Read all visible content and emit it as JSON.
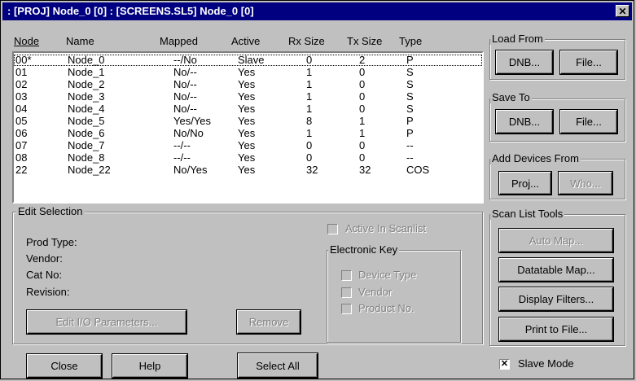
{
  "window": {
    "title": ": [PROJ] Node_0 [0] : [SCREENS.SL5] Node_0 [0]"
  },
  "table": {
    "headers": [
      "Node",
      "Name",
      "Mapped",
      "Active",
      "Rx Size",
      "Tx Size",
      "Type"
    ],
    "rows": [
      [
        "00*",
        "Node_0",
        "--/No",
        "Slave",
        "0",
        "2",
        "P"
      ],
      [
        "01",
        "Node_1",
        "No/--",
        "Yes",
        "1",
        "0",
        "S"
      ],
      [
        "02",
        "Node_2",
        "No/--",
        "Yes",
        "1",
        "0",
        "S"
      ],
      [
        "03",
        "Node_3",
        "No/--",
        "Yes",
        "1",
        "0",
        "S"
      ],
      [
        "04",
        "Node_4",
        "No/--",
        "Yes",
        "1",
        "0",
        "S"
      ],
      [
        "05",
        "Node_5",
        "Yes/Yes",
        "Yes",
        "8",
        "1",
        "P"
      ],
      [
        "06",
        "Node_6",
        "No/No",
        "Yes",
        "1",
        "1",
        "P"
      ],
      [
        "07",
        "Node_7",
        "--/--",
        "Yes",
        "0",
        "0",
        "--"
      ],
      [
        "08",
        "Node_8",
        "--/--",
        "Yes",
        "0",
        "0",
        "--"
      ],
      [
        "22",
        "Node_22",
        "No/Yes",
        "Yes",
        "32",
        "32",
        "COS"
      ]
    ]
  },
  "edit_selection": {
    "label": "Edit Selection",
    "prod_type": "Prod Type:",
    "vendor": "Vendor:",
    "cat_no": "Cat No:",
    "revision": "Revision:",
    "active_in_scanlist": "Active In Scanlist",
    "electronic_key": {
      "label": "Electronic Key",
      "device_type": "Device Type",
      "vendor": "Vendor",
      "product_no": "Product No."
    },
    "edit_io_button": "Edit I/O Parameters...",
    "remove_button": "Remove"
  },
  "load_from": {
    "label": "Load From",
    "dnb": "DNB...",
    "file": "File..."
  },
  "save_to": {
    "label": "Save To",
    "dnb": "DNB...",
    "file": "File..."
  },
  "add_devices": {
    "label": "Add Devices From",
    "proj": "Proj...",
    "who": "Who..."
  },
  "scan_list_tools": {
    "label": "Scan List Tools",
    "auto_map": "Auto Map...",
    "datatable_map": "Datatable Map...",
    "display_filters": "Display Filters...",
    "print_to_file": "Print to File..."
  },
  "slave_mode": {
    "label": "Slave Mode",
    "checked": true
  },
  "bottom": {
    "close": "Close",
    "help": "Help",
    "select_all": "Select All"
  }
}
